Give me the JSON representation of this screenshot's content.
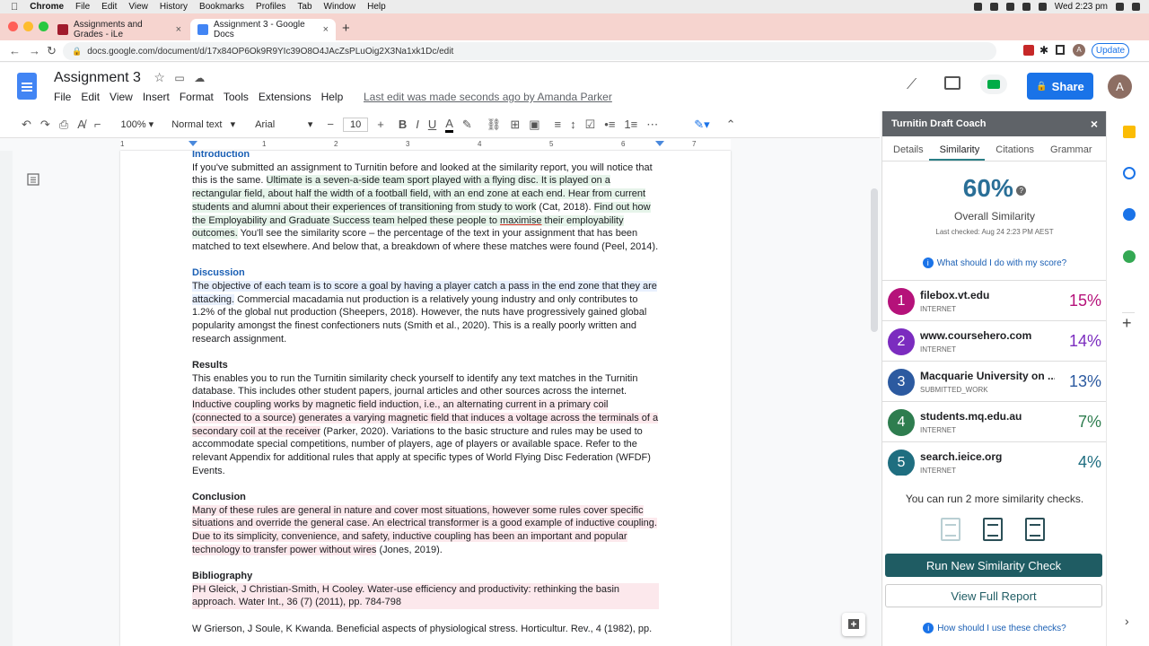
{
  "mac": {
    "app": "Chrome",
    "menus": [
      "File",
      "Edit",
      "View",
      "History",
      "Bookmarks",
      "Profiles",
      "Tab",
      "Window",
      "Help"
    ],
    "clock": "Wed 2:23 pm"
  },
  "browser": {
    "tabs": [
      {
        "title": "Assignments and Grades - iLe"
      },
      {
        "title": "Assignment 3 - Google Docs"
      }
    ],
    "url": "docs.google.com/document/d/17x84OP6Ok9R9YIc39O8O4JAcZsPLuOig2X3Na1xk1Dc/edit",
    "update_label": "Update",
    "avatar_letter": "A"
  },
  "docs": {
    "title": "Assignment 3",
    "menu": [
      "File",
      "Edit",
      "View",
      "Insert",
      "Format",
      "Tools",
      "Extensions",
      "Help"
    ],
    "last_edit": "Last edit was made seconds ago by Amanda Parker",
    "share_label": "Share",
    "avatar_letter": "A",
    "toolbar": {
      "zoom": "100%",
      "style": "Normal text",
      "font": "Arial",
      "font_size": "10"
    },
    "ruler_marks": [
      "1",
      "1",
      "2",
      "3",
      "4",
      "5",
      "6",
      "7"
    ]
  },
  "document": {
    "intro": {
      "heading": "Introduction",
      "p1": "If you've submitted an assignment to Turnitin before and looked at the similarity report, you will notice that this is the same. ",
      "p2": "Ultimate is a seven-a-side team sport played with a flying disc. It is played on a rectangular field, about half the width of a football field, with an end zone at each end.",
      "p3": " Hear from current students and alumni about their experiences of transitioning from study to work",
      "p4": " (Cat, 2018). ",
      "p5": "Find out how the Employability and Graduate Success team helped these people to ",
      "p5u": "maximise",
      "p6": " their employability outcomes.",
      "p7": " You'll see the similarity score – the percentage of the text in your assignment that has been matched to text elsewhere. And below that, a breakdown of where these matches were found (Peel, 2014)."
    },
    "discussion": {
      "heading": "Discussion",
      "p1": "The objective of each team is to score a goal by having a player catch a pass in the end zone that they are attacking.",
      "p2": " Commercial macadamia nut production is a relatively young industry and only contributes to 1.2% of the global nut production (Sheepers, 2018). However, the nuts have progressively gained global popularity amongst the finest confectioners nuts (Smith et al., 2020). This is a really poorly written and research assignment."
    },
    "results": {
      "heading": "Results",
      "p1": "This enables you to run the Turnitin similarity check yourself to identify any text matches in the Turnitin database. This includes other student papers, journal articles and other sources across the internet. ",
      "p2": "Inductive coupling works by magnetic field induction, i.e., an alternating current in a primary coil (connected to a source) generates a varying magnetic field that induces a voltage across the terminals of a secondary coil at the receiver",
      "p3": " (Parker, 2020). Variations to the basic structure and rules may be used to accommodate special competitions, number of players, age of players or available space. Refer to the relevant Appendix for additional rules that apply at specific types of World Flying Disc Federation (WFDF) Events."
    },
    "conclusion": {
      "heading": "Conclusion",
      "p1": "Many of these rules are general in nature and cover most situations, however some rules cover specific situations and override the general case. An electrical transformer is a good example of inductive coupling. Due to its simplicity, convenience, and safety, inductive coupling has been an important and popular technology to transfer power without wires",
      "p2": " (Jones, 2019)."
    },
    "bibliography": {
      "heading": "Bibliography",
      "p1": "PH Gleick, J Christian-Smith, H Cooley. Water-use efficiency and productivity: rethinking the basin approach. Water Int., 36 (7) (2011), pp. 784-798",
      "p2": "W Grierson, J Soule, K Kwanda. Beneficial aspects of physiological stress. Horticultur. Rev., 4 (1982), pp."
    }
  },
  "turnitin": {
    "title": "Turnitin Draft Coach",
    "tabs": [
      "Details",
      "Similarity",
      "Citations",
      "Grammar"
    ],
    "active_tab": "Similarity",
    "overall_pct": "60%",
    "overall_label": "Overall Similarity",
    "last_checked": "Last checked: Aug 24 2:23 PM AEST",
    "what_link": "What should I do with my score?",
    "matches": [
      {
        "num": "1",
        "name": "filebox.vt.edu",
        "type": "INTERNET",
        "pct": "15%",
        "color": "#b5127a"
      },
      {
        "num": "2",
        "name": "www.coursehero.com",
        "type": "INTERNET",
        "pct": "14%",
        "color": "#7b2cbf"
      },
      {
        "num": "3",
        "name": "Macquarie University on ...",
        "type": "SUBMITTED_WORK",
        "pct": "13%",
        "color": "#2c5aa0"
      },
      {
        "num": "4",
        "name": "students.mq.edu.au",
        "type": "INTERNET",
        "pct": "7%",
        "color": "#2e7d4f"
      },
      {
        "num": "5",
        "name": "search.ieice.org",
        "type": "INTERNET",
        "pct": "4%",
        "color": "#1f6e80"
      }
    ],
    "remaining": "You can run 2 more similarity checks.",
    "run_label": "Run New Similarity Check",
    "report_label": "View Full Report",
    "how_link": "How should I use these checks?"
  }
}
